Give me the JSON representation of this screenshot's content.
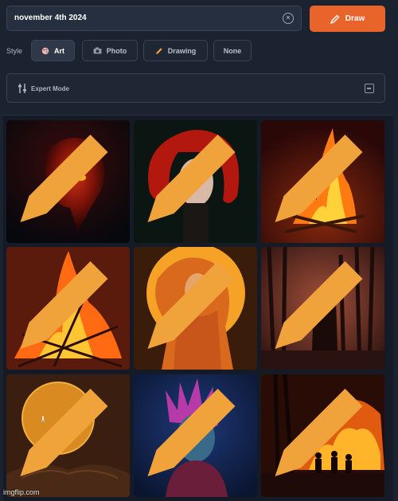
{
  "prompt": {
    "value": "november 4th 2024"
  },
  "draw_button": {
    "label": "Draw"
  },
  "style": {
    "label": "Style",
    "options": [
      "Art",
      "Photo",
      "Drawing",
      "None"
    ],
    "selected": "Art"
  },
  "expert_mode": {
    "label": "Expert Mode"
  },
  "gallery": {
    "items": [
      "red-mask-face",
      "red-haired-woman",
      "bonfire",
      "bonfire-large",
      "orange-woman-moon",
      "figure-in-forest",
      "moon-over-book",
      "blue-boy-purple-hair",
      "forest-fire-people"
    ]
  },
  "watermark": "imgflip.com",
  "colors": {
    "accent": "#e8642a",
    "background": "#1b2230",
    "field": "#262f3f"
  }
}
